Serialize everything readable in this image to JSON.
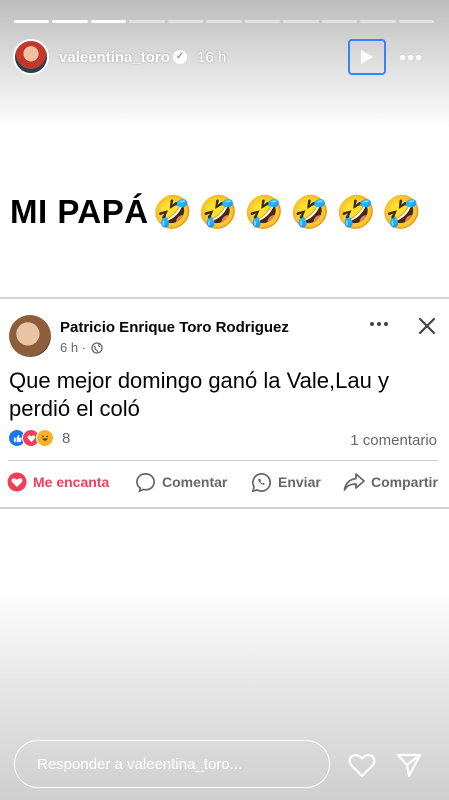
{
  "story": {
    "username": "valeentina_toro",
    "time": "16 h",
    "segments_total": 11,
    "segments_viewed": 3
  },
  "headline": {
    "text": "MI PAPÁ",
    "emoji": "🤣",
    "emoji_count": 6
  },
  "fb_post": {
    "author": "Patricio Enrique Toro Rodriguez",
    "time": "6 h ·",
    "text": "Que mejor domingo ganó la Vale,Lau y perdió el coló",
    "reaction_count": "8",
    "comments": "1 comentario",
    "actions": {
      "love": "Me encanta",
      "comment": "Comentar",
      "send": "Enviar",
      "share": "Compartir"
    }
  },
  "reply": {
    "placeholder": "Responder a valeentina_toro..."
  },
  "colors": {
    "verified_badge": "#ffffff",
    "fb_love": "#f33e58",
    "fb_like": "#1877f2",
    "play_focus": "#3b82f6"
  }
}
